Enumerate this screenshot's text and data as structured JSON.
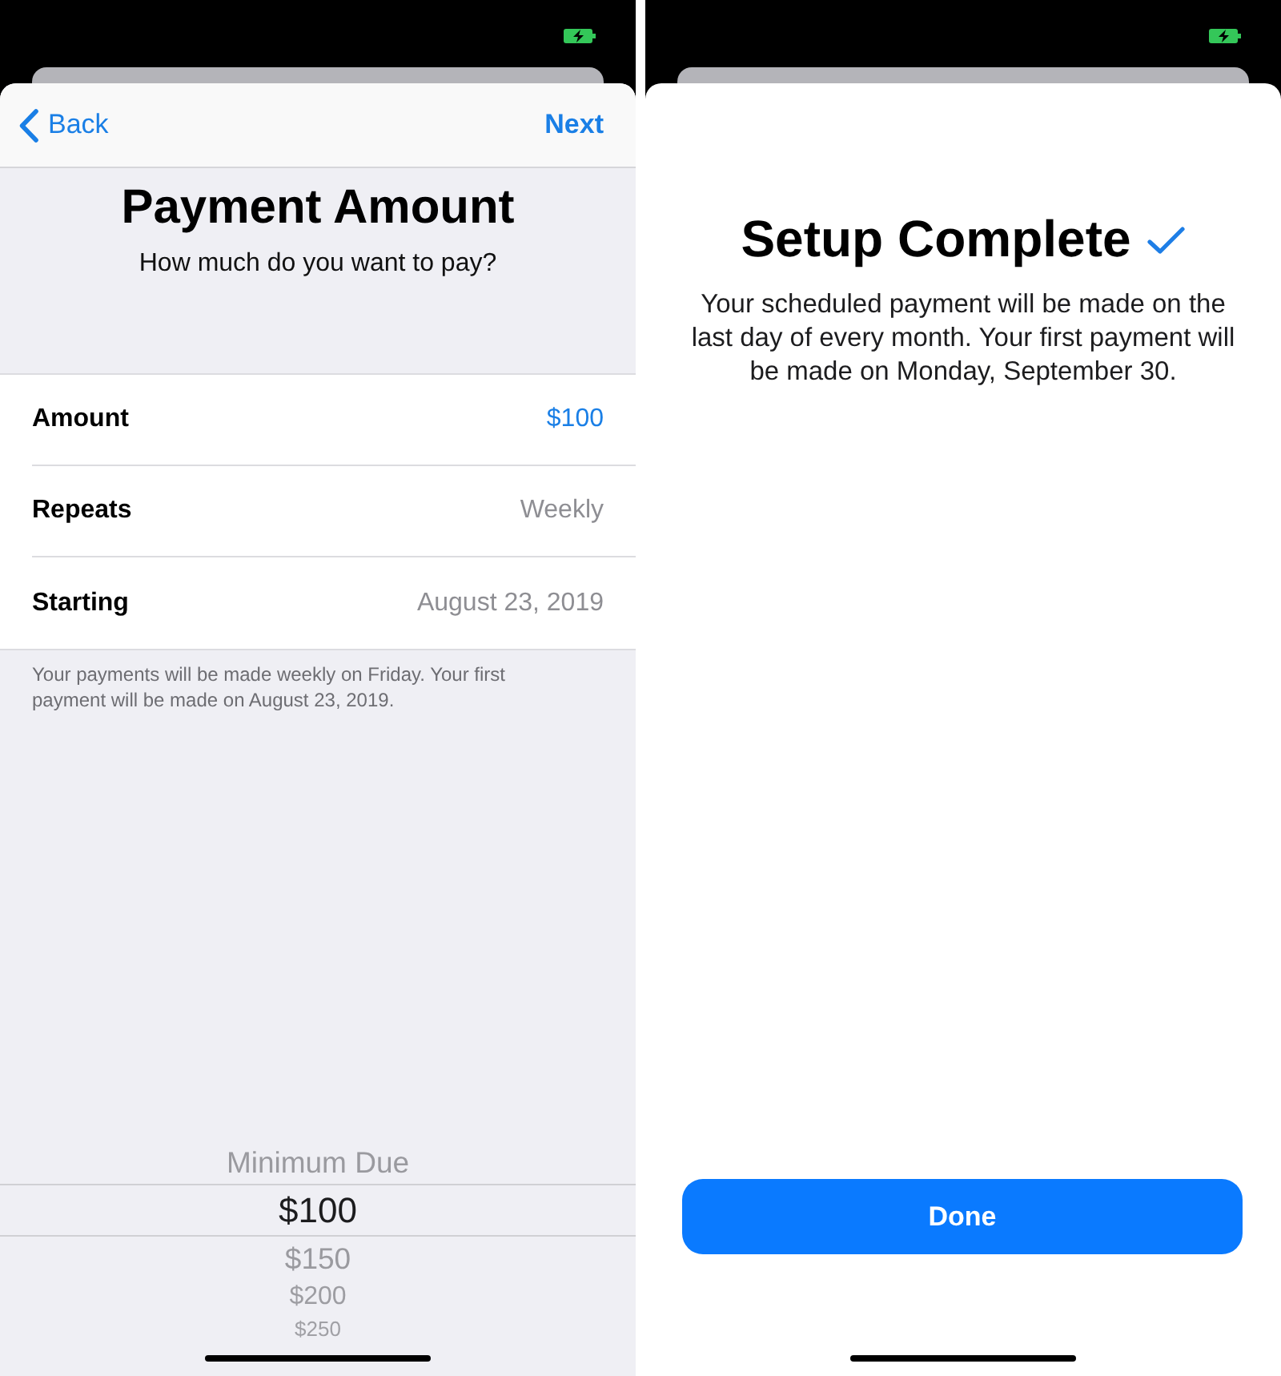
{
  "payment_screen": {
    "nav_bar": {
      "back": "Back",
      "next": "Next"
    },
    "title": "Payment Amount",
    "subtitle": "How much do you want to pay?",
    "rows": [
      {
        "label": "Amount",
        "value": "$100",
        "selected": true
      },
      {
        "label": "Repeats",
        "value": "Weekly",
        "selected": false
      },
      {
        "label": "Starting",
        "value": "August 23, 2019",
        "selected": false
      }
    ],
    "footnote": "Your payments will be made weekly on Friday. Your first payment will be made on August 23, 2019.",
    "picker": {
      "options": [
        {
          "label": "Minimum Due",
          "selected": false
        },
        {
          "label": "$100",
          "selected": true
        },
        {
          "label": "$150",
          "selected": false
        },
        {
          "label": "$200",
          "selected": false
        },
        {
          "label": "$250",
          "selected": false
        }
      ]
    }
  },
  "complete_screen": {
    "title": "Setup Complete",
    "message": "Your scheduled payment will be made on the last day of every month. Your first payment will be made on Monday, September 30.",
    "button": "Done"
  }
}
